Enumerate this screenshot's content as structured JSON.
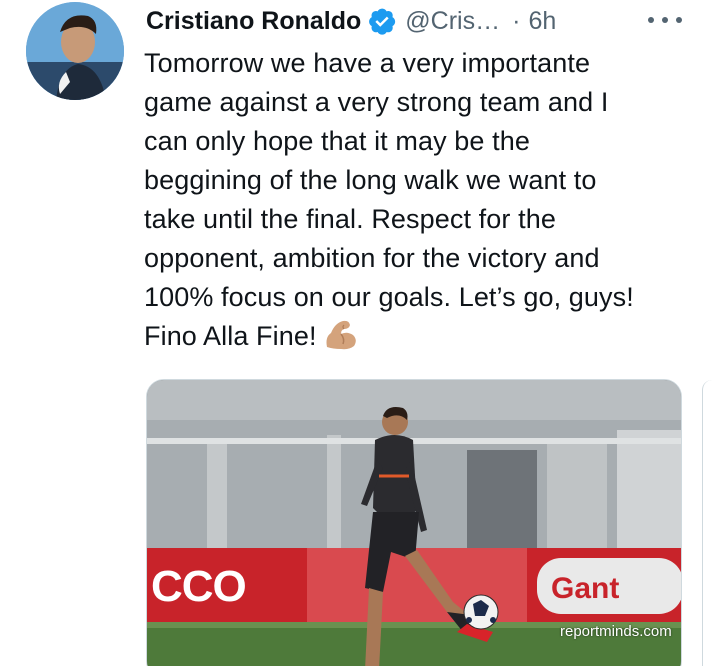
{
  "tweet": {
    "author_name": "Cristiano Ronaldo",
    "handle": "@Cris…",
    "separator": "·",
    "time": "6h",
    "text": "Tomorrow we have a very importante\ngame against a very strong team and I\ncan only hope that it may be the\nbeggining of the long walk we want to\ntake until the final. Respect for the\nopponent, ambition for the victory and\n100% focus on our goals. Let’s go, guys!\nFino Alla Fine!",
    "emoji": "flexed-biceps-emoji",
    "verified_color": "#1d9bf0",
    "more_icon": "more-horizontal-icon"
  },
  "media": {
    "watermark": "reportminds.com",
    "banner_text_left": "CCO",
    "banner_text_right": "Gant",
    "banner_color": "#d0282e"
  }
}
